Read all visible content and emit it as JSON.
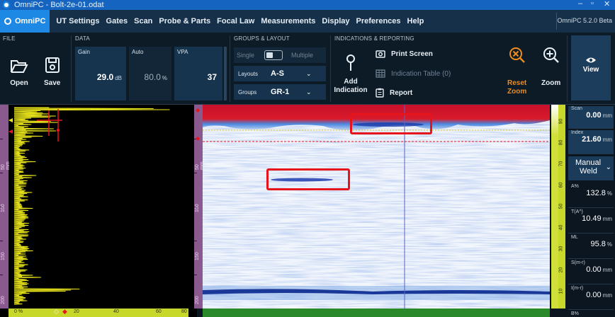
{
  "window": {
    "title": "OmniPC - Bolt-2e-01.odat"
  },
  "menu": {
    "home": "OmniPC",
    "items": [
      "UT Settings",
      "Gates",
      "Scan",
      "Probe & Parts",
      "Focal Law",
      "Measurements",
      "Display",
      "Preferences",
      "Help"
    ],
    "version": "OmniPC 5.2.0 Beta"
  },
  "ribbon": {
    "file": {
      "header": "FILE",
      "open": "Open",
      "save": "Save"
    },
    "data": {
      "header": "DATA",
      "gain_label": "Gain",
      "gain_value": "29.0",
      "gain_unit": "dB",
      "auto_label": "Auto",
      "auto_value": "80.0",
      "auto_unit": "%",
      "vpa_label": "VPA",
      "vpa_value": "37"
    },
    "groups_layout": {
      "header": "GROUPS & LAYOUT",
      "single": "Single",
      "multiple": "Multiple",
      "layouts_label": "Layouts",
      "layouts_value": "A-S",
      "groups_label": "Groups",
      "groups_value": "GR-1"
    },
    "indications": {
      "header": "INDICATIONS & REPORTING",
      "add_indication_1": "Add",
      "add_indication_2": "Indication",
      "print_screen": "Print Screen",
      "indication_table": "Indication Table (0)",
      "report": "Report",
      "reset_zoom_1": "Reset",
      "reset_zoom_2": "Zoom",
      "zoom": "Zoom",
      "view": "View"
    }
  },
  "ascan": {
    "depth_ticks": [
      "50 mm",
      "100",
      "150",
      "200"
    ],
    "amp_ticks": [
      "0 %",
      "20",
      "40",
      "60",
      "80"
    ]
  },
  "bscan": {
    "right_ticks": [
      "90",
      "80",
      "70",
      "60",
      "50",
      "40",
      "30",
      "20",
      "10"
    ]
  },
  "readings": {
    "scan_label": "Scan",
    "scan_value": "0.00",
    "scan_unit": "mm",
    "index_label": "Index",
    "index_value": "21.60",
    "index_unit": "mm",
    "weld_1": "Manual",
    "weld_2": "Weld",
    "a_label": "A%",
    "a_value": "132.8",
    "a_unit": "%",
    "t_label": "T(A^)",
    "t_value": "10.49",
    "t_unit": "mm",
    "ml_label": "ML",
    "ml_value": "95.8",
    "ml_unit": "%",
    "s_label": "S(m-r)",
    "s_value": "0.00",
    "s_unit": "mm",
    "i_label": "I(m-r)",
    "i_value": "0.00",
    "i_unit": "mm",
    "b_label": "B%"
  },
  "colors": {
    "accent": "#1e88e5",
    "menubar": "#163049",
    "data_box": "#17344f",
    "highlight_box": "#e8141c",
    "ascan_trace": "#e6e21a",
    "gate": "#e8141c"
  }
}
